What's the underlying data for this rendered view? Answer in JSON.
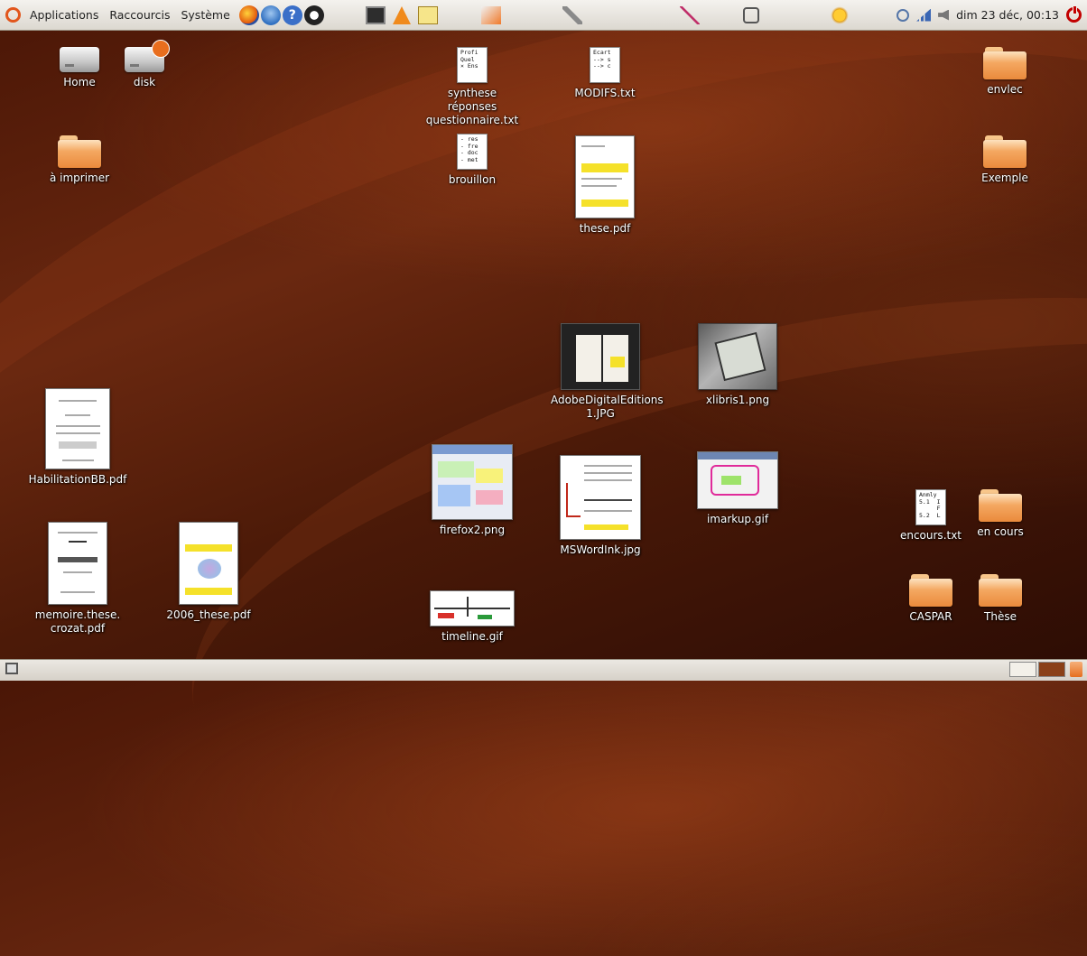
{
  "top_panel": {
    "menus": [
      "Applications",
      "Raccourcis",
      "Système"
    ],
    "launchers": [
      "firefox-icon",
      "thunderbird-icon",
      "help-icon",
      "gimp-icon"
    ],
    "apps": [
      "terminal-icon",
      "vlc-icon",
      "text-editor-icon",
      "screenshot-icon",
      "paint-icon",
      "vector-draw-icon",
      "save-icon",
      "weather-icon"
    ],
    "clock": "dim 23 déc, 00:13"
  },
  "desktop": {
    "home": "Home",
    "disk": "disk",
    "imprimer": "à imprimer",
    "synthese": "synthese réponses questionnaire.txt",
    "synthese_preview": [
      "Profi",
      "",
      "Quel",
      "× Ens"
    ],
    "modifs": "MODIFS.txt",
    "modifs_preview": [
      "Ecart",
      "--> s",
      "--> c"
    ],
    "brouillon": "brouillon",
    "brouillon_preview": [
      "- res",
      "- fre",
      "- doc",
      "- met"
    ],
    "these": "these.pdf",
    "envlec": "envlec",
    "exemple": "Exemple",
    "adobe": "AdobeDigitalEditions 1.JPG",
    "xlibris": "xlibris1.png",
    "habilitation": "HabilitationBB.pdf",
    "firefox2": "firefox2.png",
    "mswordink": "MSWordInk.jpg",
    "imarkup": "imarkup.gif",
    "encours_txt": "encours.txt",
    "encours_txt_preview": [
      "Anmly",
      "5.1  I",
      "     F",
      "5.2  L"
    ],
    "en_cours": "en cours",
    "memoire": "memoire.these. crozat.pdf",
    "these2006": "2006_these.pdf",
    "timeline": "timeline.gif",
    "caspar": "CASPAR",
    "these_folder": "Thèse"
  },
  "colors": {
    "panel": "#dcd8d0",
    "folder": "#f4a861",
    "desktop": "#5a1f0a",
    "highlight": "#f5e12a"
  }
}
